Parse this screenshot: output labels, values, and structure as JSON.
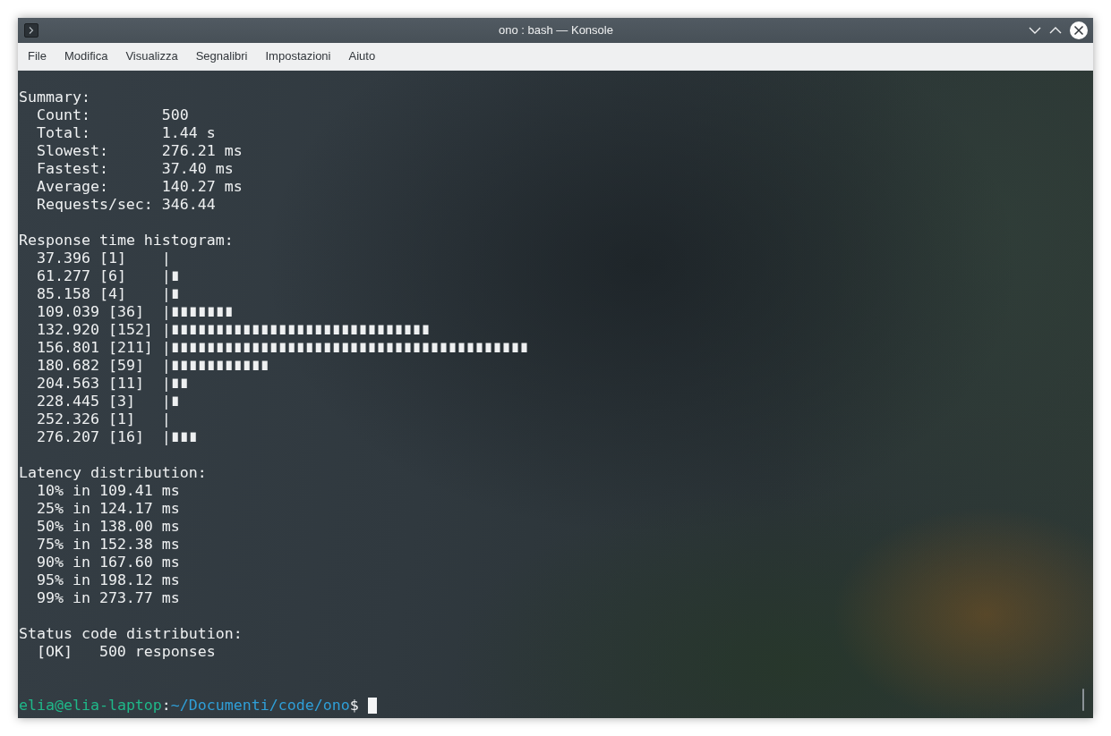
{
  "window": {
    "title": "ono : bash — Konsole"
  },
  "menu": [
    "File",
    "Modifica",
    "Visualizza",
    "Segnalibri",
    "Impostazioni",
    "Aiuto"
  ],
  "terminal": {
    "summary": {
      "heading": "Summary:",
      "rows": [
        {
          "label": "Count:",
          "value": "500"
        },
        {
          "label": "Total:",
          "value": "1.44 s"
        },
        {
          "label": "Slowest:",
          "value": "276.21 ms"
        },
        {
          "label": "Fastest:",
          "value": "37.40 ms"
        },
        {
          "label": "Average:",
          "value": "140.27 ms"
        },
        {
          "label": "Requests/sec:",
          "value": "346.44"
        }
      ]
    },
    "histogram": {
      "heading": "Response time histogram:",
      "rows": [
        {
          "bucket": "37.396",
          "count": "[1]",
          "bar": "|"
        },
        {
          "bucket": "61.277",
          "count": "[6]",
          "bar": "|∎"
        },
        {
          "bucket": "85.158",
          "count": "[4]",
          "bar": "|∎"
        },
        {
          "bucket": "109.039",
          "count": "[36]",
          "bar": "|∎∎∎∎∎∎∎"
        },
        {
          "bucket": "132.920",
          "count": "[152]",
          "bar": "|∎∎∎∎∎∎∎∎∎∎∎∎∎∎∎∎∎∎∎∎∎∎∎∎∎∎∎∎∎"
        },
        {
          "bucket": "156.801",
          "count": "[211]",
          "bar": "|∎∎∎∎∎∎∎∎∎∎∎∎∎∎∎∎∎∎∎∎∎∎∎∎∎∎∎∎∎∎∎∎∎∎∎∎∎∎∎∎"
        },
        {
          "bucket": "180.682",
          "count": "[59]",
          "bar": "|∎∎∎∎∎∎∎∎∎∎∎"
        },
        {
          "bucket": "204.563",
          "count": "[11]",
          "bar": "|∎∎"
        },
        {
          "bucket": "228.445",
          "count": "[3]",
          "bar": "|∎"
        },
        {
          "bucket": "252.326",
          "count": "[1]",
          "bar": "|"
        },
        {
          "bucket": "276.207",
          "count": "[16]",
          "bar": "|∎∎∎"
        }
      ]
    },
    "latency": {
      "heading": "Latency distribution:",
      "rows": [
        "10% in 109.41 ms",
        "25% in 124.17 ms",
        "50% in 138.00 ms",
        "75% in 152.38 ms",
        "90% in 167.60 ms",
        "95% in 198.12 ms",
        "99% in 273.77 ms"
      ]
    },
    "status_codes": {
      "heading": "Status code distribution:",
      "rows": [
        {
          "code": "[OK]",
          "text": "500 responses"
        }
      ]
    },
    "prompt": {
      "user_host": "elia@elia-laptop",
      "separator": ":",
      "path": "~/Documenti/code/ono",
      "symbol": "$"
    }
  }
}
